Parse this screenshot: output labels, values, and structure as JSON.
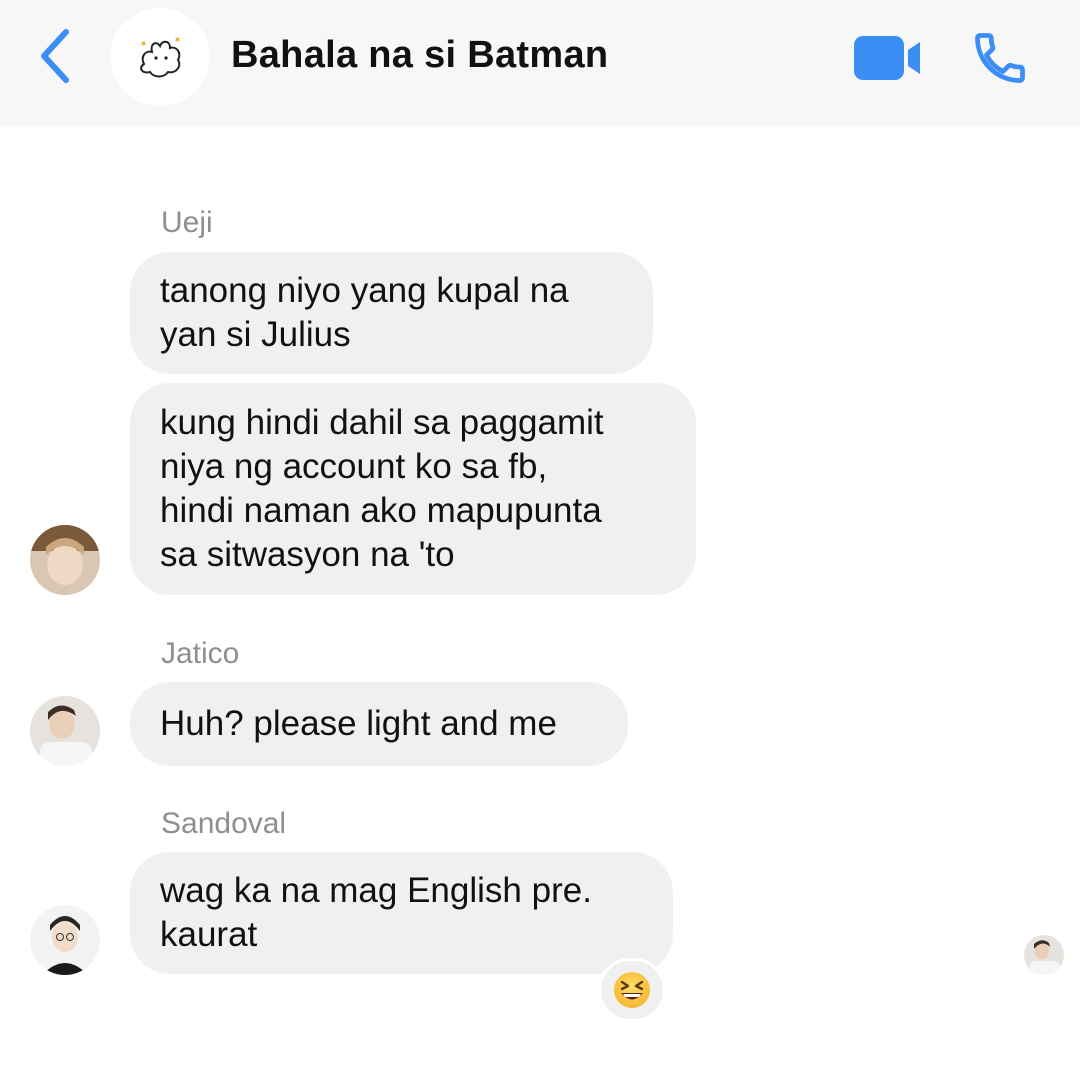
{
  "header": {
    "title": "Bahala na si Batman",
    "back_icon": "chevron-left-icon",
    "video_icon": "video-camera-icon",
    "call_icon": "phone-icon",
    "accent_color": "#3b8ef3"
  },
  "messages": [
    {
      "sender": "Ueji",
      "texts": [
        "tanong niyo yang kupal na\nyan si Julius",
        "kung hindi dahil sa paggamit\nniya ng account ko sa fb,\nhindi naman ako mapupunta\nsa sitwasyon na 'to"
      ]
    },
    {
      "sender": "Jatico",
      "texts": [
        "Huh? please light and me"
      ]
    },
    {
      "sender": "Sandoval",
      "texts": [
        "wag ka na mag English pre.\nkaurat"
      ],
      "reaction": "grinning-squinting-face-emoji"
    }
  ],
  "colors": {
    "bubble": "#f0f0f0",
    "sender_name": "#8e8e93",
    "header_bg": "#f7f7f8"
  }
}
